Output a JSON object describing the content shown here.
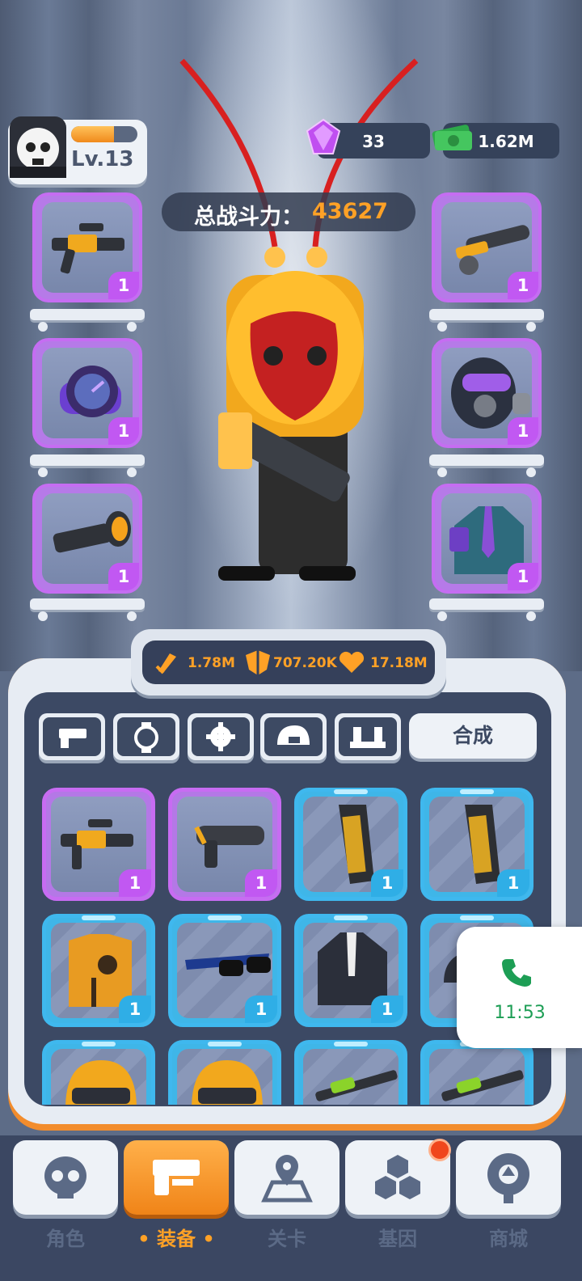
{
  "player": {
    "level": "Lv.13",
    "xp_fraction": 0.65
  },
  "currency": {
    "gems": "33",
    "cash": "1.62M"
  },
  "combat_power": {
    "label": "总战斗力：",
    "value": "43627"
  },
  "equipped": {
    "left": [
      {
        "name": "assault-rifle",
        "count": "1"
      },
      {
        "name": "wrist-device",
        "count": "1"
      },
      {
        "name": "scope",
        "count": "1"
      }
    ],
    "right": [
      {
        "name": "shotgun",
        "count": "1"
      },
      {
        "name": "gas-mask",
        "count": "1"
      },
      {
        "name": "suit-armor",
        "count": "1"
      }
    ]
  },
  "stats": {
    "attack": "1.78M",
    "defense": "707.20K",
    "health": "17.18M"
  },
  "tabs": [
    "gun",
    "watch",
    "gear",
    "helmet",
    "boots"
  ],
  "merge_label": "合成",
  "inventory": [
    {
      "name": "assault-rifle",
      "rarity": "purple",
      "count": "1"
    },
    {
      "name": "shotgun",
      "rarity": "purple",
      "count": "1"
    },
    {
      "name": "magazine",
      "rarity": "blue",
      "count": "1"
    },
    {
      "name": "magazine",
      "rarity": "blue",
      "count": "1"
    },
    {
      "name": "vest",
      "rarity": "blue",
      "count": "1"
    },
    {
      "name": "sunglasses",
      "rarity": "blue",
      "count": "1"
    },
    {
      "name": "jacket",
      "rarity": "blue",
      "count": "1"
    },
    {
      "name": "cap",
      "rarity": "blue",
      "count": "1"
    },
    {
      "name": "helmet",
      "rarity": "blue",
      "count": ""
    },
    {
      "name": "helmet",
      "rarity": "blue",
      "count": ""
    },
    {
      "name": "green-rifle",
      "rarity": "blue",
      "count": ""
    },
    {
      "name": "green-rifle",
      "rarity": "blue",
      "count": ""
    }
  ],
  "call": {
    "time": "11:53"
  },
  "nav": [
    {
      "label": "角色",
      "icon": "skull-icon",
      "active": false
    },
    {
      "label": "装备",
      "icon": "gun-icon",
      "active": true
    },
    {
      "label": "关卡",
      "icon": "map-icon",
      "active": false
    },
    {
      "label": "基因",
      "icon": "hex-icon",
      "active": false
    },
    {
      "label": "商城",
      "icon": "shop-icon",
      "active": false
    }
  ],
  "colors": {
    "purple": "#c76cf2",
    "blue": "#3fb8ee",
    "orange": "#ffa126",
    "panel_dark": "#3c4964"
  }
}
